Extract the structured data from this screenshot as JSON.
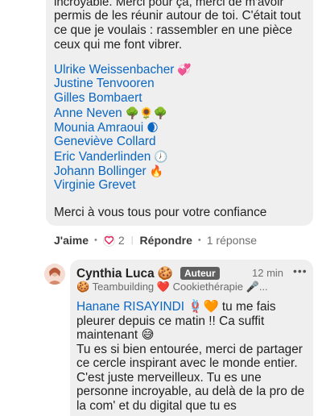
{
  "post": {
    "clip_line": "incroyable. Merci pour ça, merci de m'avoir",
    "text": "permis de les réunir autour de toi. C'était tout ce que je voulais : rassembler en une pièce ceux qui me font vibrer.",
    "mentions": [
      {
        "name": "Ulrike Weissenbacher",
        "emoji": "💞"
      },
      {
        "name": "Justine Tenvooren",
        "emoji": ""
      },
      {
        "name": "Gilles Bombaert",
        "emoji": ""
      },
      {
        "name": "Anne Neven",
        "emoji": "🌳🌻🌳"
      },
      {
        "name": "Mounia Amraoui",
        "emoji": "🌒"
      },
      {
        "name": "Geneviève Collard",
        "emoji": ""
      },
      {
        "name": "Eric Vanderlinden",
        "emoji": "🕖"
      },
      {
        "name": "Johann Bollinger",
        "emoji": "🔥"
      },
      {
        "name": "Virginie Grevet",
        "emoji": ""
      }
    ],
    "thanks": "Merci à vous tous pour votre confiance"
  },
  "actions": {
    "like": "J'aime",
    "reaction_count": "2",
    "reply": "Répondre",
    "replies": "1 réponse"
  },
  "reply_comment": {
    "author": "Cynthia Luca 🍪",
    "badge": "Auteur",
    "time": "12 min",
    "more": "•••",
    "tagline": "🍪 Teambuilding ❤️ Cookiethérapie 🎤...",
    "mention": "Hanane RISAYINDI",
    "mention_emoji": "🪢🧡",
    "text": "tu me fais pleurer depuis ce matin !! Ca suffit maintenant 😅",
    "text2": "Tu es si bien entourée, merci de partager ce cercle inspirant avec le monde entier. C'est juste merveilleux. Tu es une personne incroyable, au delà de la pro de la com' et du digital que tu es"
  },
  "colors": {
    "mention": "#0a66c2",
    "bubble": "#efefef",
    "heart": "#e0245e"
  }
}
